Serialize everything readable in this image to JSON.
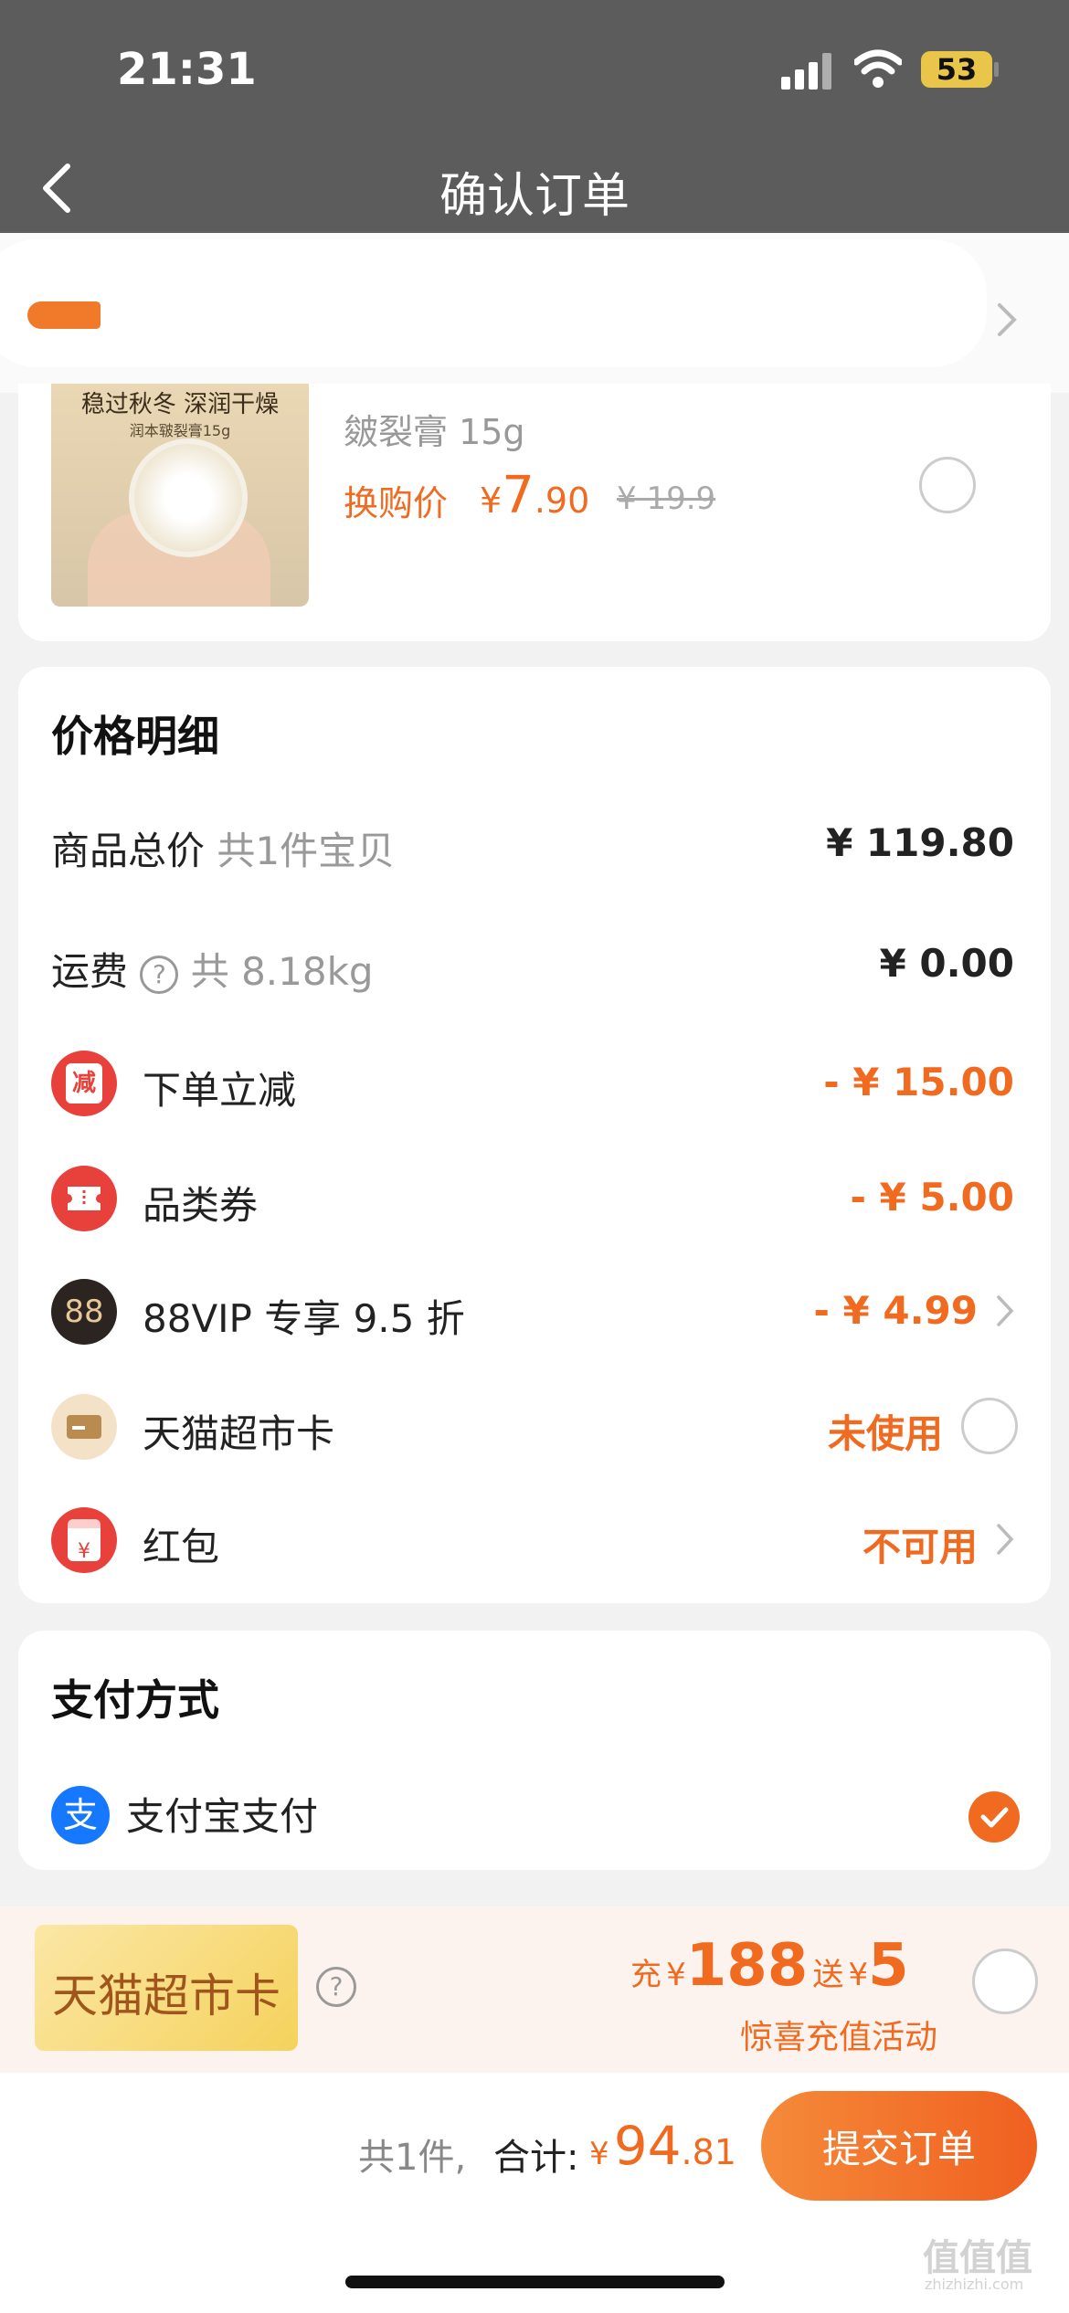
{
  "status": {
    "time": "21:31",
    "battery": "53"
  },
  "nav": {
    "title": "确认订单"
  },
  "product": {
    "image_title": "稳过秋冬 深润干燥",
    "image_sub": "润本皲裂膏15g",
    "spec": "皴裂膏 15g",
    "swap_label": "换购价",
    "swap_price_currency": "¥",
    "swap_price_int": "7",
    "swap_price_dec": ".90",
    "old_price": "¥ 19.9"
  },
  "price_detail": {
    "title": "价格明细",
    "rows": [
      {
        "label": "商品总价",
        "hint": "共1件宝贝",
        "value": "¥ 119.80"
      },
      {
        "label": "运费",
        "hint": "共 8.18kg",
        "value": "¥ 0.00"
      },
      {
        "label": "下单立减",
        "icon": "discount-icon",
        "icon_text": "减",
        "value": "- ¥ 15.00"
      },
      {
        "label": "品类券",
        "icon": "coupon-icon",
        "value": "- ¥ 5.00"
      },
      {
        "label": "88VIP 专享 9.5 折",
        "icon": "vip88-icon",
        "icon_text": "88",
        "value": "- ¥ 4.99"
      },
      {
        "label": "天猫超市卡",
        "icon": "card-icon",
        "value": "未使用"
      },
      {
        "label": "红包",
        "icon": "red-packet-icon",
        "icon_text": "¥",
        "value": "不可用"
      }
    ]
  },
  "payment": {
    "title": "支付方式",
    "method": "支付宝支付",
    "icon_text": "支"
  },
  "promo": {
    "card_label": "天猫超市卡",
    "charge_label": "充",
    "currency": "¥",
    "charge_amount": "188",
    "gift_label": "送",
    "gift_amount": "5",
    "subtitle": "惊喜充值活动"
  },
  "footer": {
    "count": "共1件,",
    "total_label": "合计:",
    "total_currency": "¥",
    "total_int": "94",
    "total_dec": ".81",
    "submit_label": "提交订单"
  },
  "watermark": {
    "main": "值值值",
    "sub": "zhizhizhi.com"
  },
  "colors": {
    "accent": "#f06a20",
    "red": "#e8403a",
    "overlay": "#5c5c5c"
  }
}
